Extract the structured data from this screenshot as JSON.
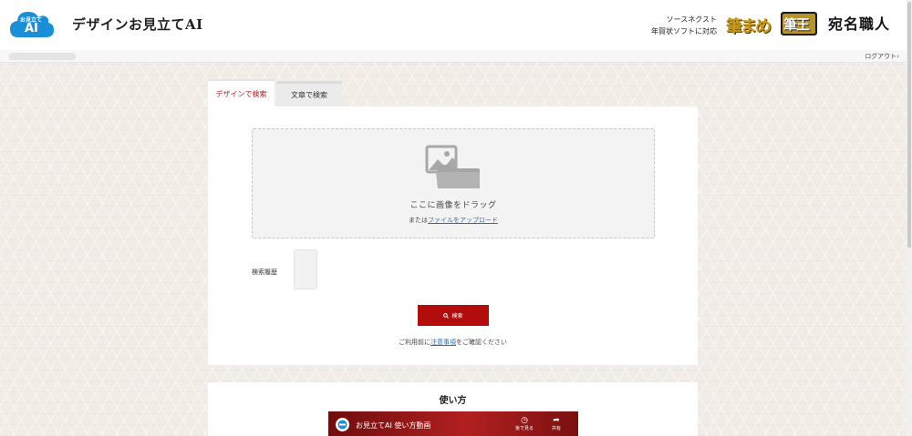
{
  "header": {
    "logo_text_top": "お見立て",
    "logo_text_bottom": "AI",
    "site_title": "デザインお見立てAI",
    "promo_line1": "ソースネクスト",
    "promo_line2": "年賀状ソフトに対応",
    "brand1": "筆まめ",
    "brand2": "筆王",
    "brand3": "宛名職人"
  },
  "subbar": {
    "logout_label": "ログアウト›"
  },
  "tabs": [
    {
      "label": "デザインで検索",
      "active": true
    },
    {
      "label": "文章で検索",
      "active": false
    }
  ],
  "upload": {
    "main_text": "ここに画像をドラッグ",
    "sub_prefix": "または",
    "sub_link": "ファイルをアップロード"
  },
  "history": {
    "label": "検索履歴"
  },
  "search_button": {
    "label": "検索",
    "icon": "search-icon"
  },
  "notice": {
    "prefix": "ご利用前に",
    "link": "注意事項",
    "suffix": "をご確認ください"
  },
  "howto": {
    "title": "使い方",
    "video_title": "お見立てAI 使い方動画",
    "watch_later": "後で見る",
    "share": "共有"
  },
  "colors": {
    "accent_red": "#b30c0c",
    "link_blue": "#2a6fb0",
    "logo_blue": "#1a8fd8"
  }
}
